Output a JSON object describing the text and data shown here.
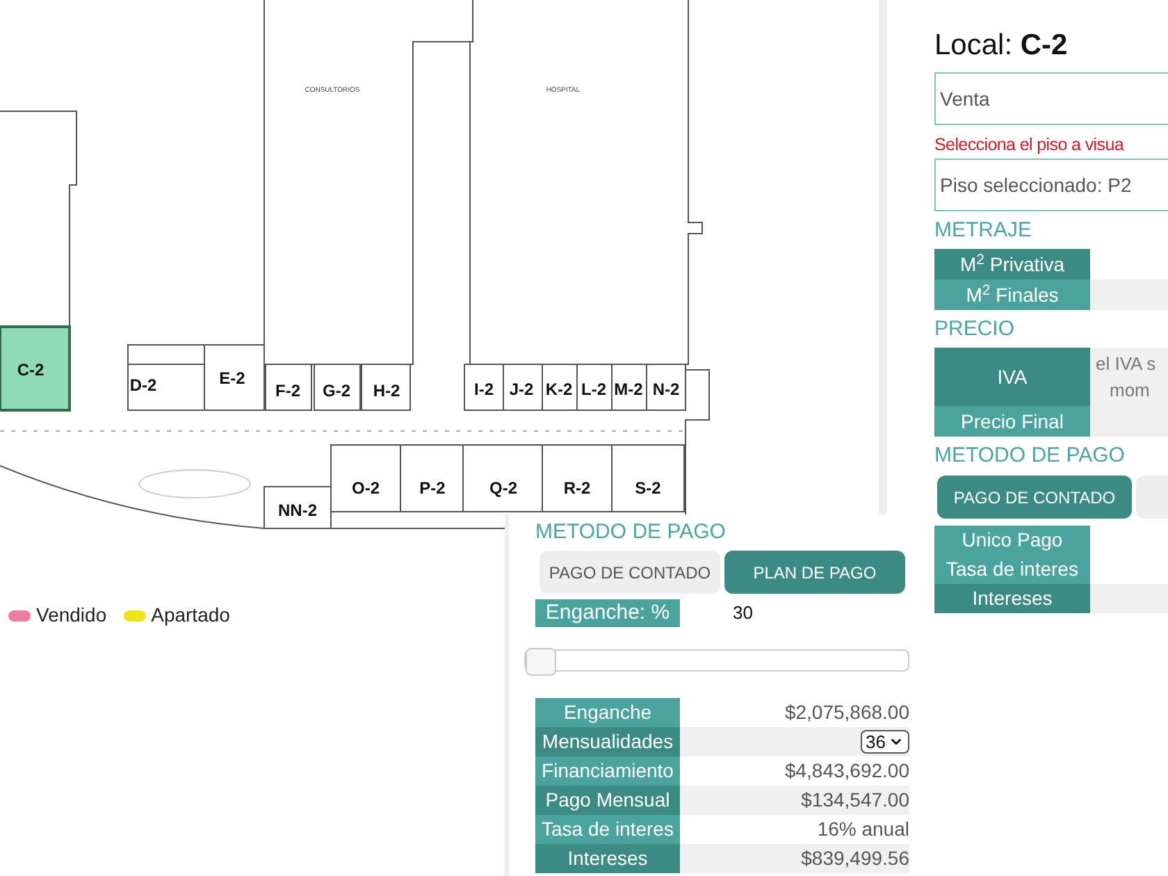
{
  "floor_plan": {
    "areas": [
      "CONSULTORIOS",
      "HOSPITAL"
    ],
    "units": [
      {
        "label": "C-2",
        "selected": true
      },
      {
        "label": "D-2",
        "selected": false
      },
      {
        "label": "E-2",
        "selected": false
      },
      {
        "label": "F-2",
        "selected": false
      },
      {
        "label": "G-2",
        "selected": false
      },
      {
        "label": "H-2",
        "selected": false
      },
      {
        "label": "I-2",
        "selected": false
      },
      {
        "label": "J-2",
        "selected": false
      },
      {
        "label": "K-2",
        "selected": false
      },
      {
        "label": "L-2",
        "selected": false
      },
      {
        "label": "M-2",
        "selected": false
      },
      {
        "label": "N-2",
        "selected": false
      },
      {
        "label": "O-2",
        "selected": false
      },
      {
        "label": "P-2",
        "selected": false
      },
      {
        "label": "Q-2",
        "selected": false
      },
      {
        "label": "R-2",
        "selected": false
      },
      {
        "label": "S-2",
        "selected": false
      },
      {
        "label": "NN-2",
        "selected": false
      }
    ],
    "legend": [
      {
        "label": "Vendido",
        "color": "#f07ca0"
      },
      {
        "label": "Apartado",
        "color": "#f2e21a"
      }
    ]
  },
  "detail": {
    "title": "Local: **C-2**",
    "operation": "Venta",
    "floor_prompt": "Selecciona el piso a visua",
    "floor": "Piso seleccionado: P2",
    "sections": [
      {
        "heading": "METRAJE",
        "rows": [
          {
            "label": "M$^{2}$ Privativa"
          },
          {
            "label": "M$^{2}$ Finales"
          }
        ]
      },
      {
        "heading": "PRECIO",
        "rows": [
          {
            "label": "IVA",
            "value_lines": [
              "el IVA s",
              "mom"
            ]
          },
          {
            "label": "Precio Final"
          }
        ]
      }
    ],
    "payment_heading": "METODO DE PAGO",
    "payment_tabs": [
      {
        "label": "PAGO DE CONTADO",
        "selected": true
      }
    ],
    "payment_rows": [
      {
        "label": "Unico Pago"
      },
      {
        "label": "Tasa de interes"
      },
      {
        "label": "Intereses"
      }
    ]
  },
  "plan": {
    "heading": "METODO DE PAGO",
    "tabs": [
      {
        "label": "PAGO DE CONTADO",
        "selected": false
      },
      {
        "label": "PLAN DE PAGO",
        "selected": true
      }
    ],
    "down_payment_label": "Enganche: %",
    "down_payment_value": "30",
    "slider": {
      "level": 0
    },
    "rows": [
      {
        "kind": "text",
        "label": "Enganche",
        "value": "$2,075,868.00"
      },
      {
        "kind": "select",
        "label": "Mensualidades",
        "value": "36"
      },
      {
        "kind": "text",
        "label": "Financiamiento",
        "value": "$4,843,692.00"
      },
      {
        "kind": "text",
        "label": "Pago Mensual",
        "value": "$134,547.00"
      },
      {
        "kind": "text",
        "label": "Tasa de interes",
        "value": "16% anual"
      },
      {
        "kind": "text",
        "label": "Intereses",
        "value": "$839,499.56"
      }
    ]
  }
}
